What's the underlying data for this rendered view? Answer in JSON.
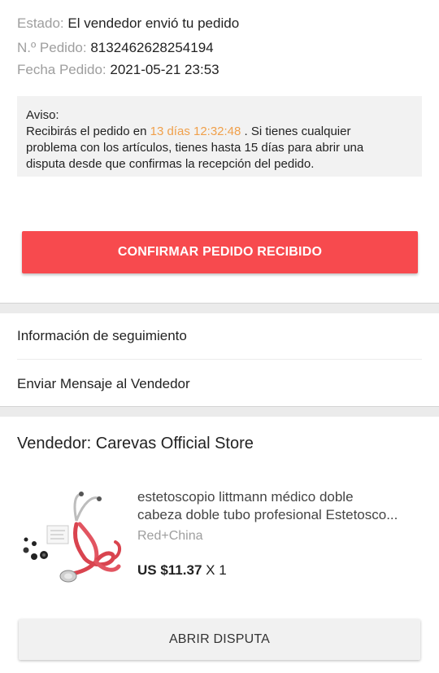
{
  "order": {
    "status_label": "Estado:",
    "status_value": "El vendedor envió tu pedido",
    "number_label": "N.º Pedido:",
    "number_value": "8132462628254194",
    "date_label": "Fecha Pedido:",
    "date_value": "2021-05-21 23:53"
  },
  "notice": {
    "title": "Aviso:",
    "text_before": "Recibirás el pedido en",
    "countdown": "13 días 12:32:48",
    "text_line1_end": ". Si tienes cualquier",
    "text_line2": "problema con los artículos, tienes hasta 15 días para abrir una",
    "text_line3": "disputa desde que confirmas la recepción del pedido.",
    "highlight_color": "#f0a04b"
  },
  "confirm_button": {
    "label": "CONFIRMAR PEDIDO RECIBIDO",
    "color": "#f74a4e"
  },
  "menu": {
    "tracking": "Información de seguimiento",
    "message_seller": "Enviar Mensaje al Vendedor"
  },
  "seller": {
    "label": "Vendedor: Carevas Official Store"
  },
  "product": {
    "title_line1": "estetoscopio littmann médico doble",
    "title_line2": "cabeza doble tubo profesional Estetosco...",
    "variant": "Red+China",
    "price": "US $11.37",
    "quantity": "X 1",
    "image_icon": "stethoscope-image"
  },
  "dispute_button": {
    "label": "ABRIR DISPUTA"
  }
}
